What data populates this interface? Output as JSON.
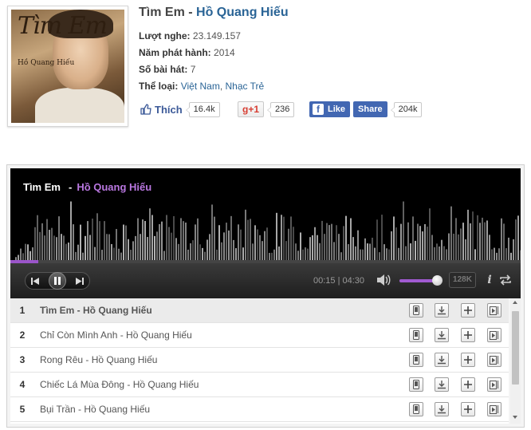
{
  "album": {
    "title": "Tìm Em",
    "separator": "-",
    "artist": "Hồ Quang Hiếu",
    "cover_art_text": {
      "title": "Tìm Em",
      "artist": "Hồ Quang Hiếu"
    },
    "listens_label": "Lượt nghe:",
    "listens_value": "23.149.157",
    "year_label": "Năm phát hành:",
    "year_value": "2014",
    "tracks_label": "Số bài hát:",
    "tracks_value": "7",
    "genre_label": "Thể loại:",
    "genres": [
      "Việt Nam",
      "Nhạc Trẻ"
    ],
    "genre_separator": ","
  },
  "social": {
    "like_label": "Thích",
    "like_count": "16.4k",
    "gplus_label": "g+1",
    "gplus_count": "236",
    "fb_like_label": "Like",
    "fb_share_label": "Share",
    "fb_count": "204k",
    "fb_color": "#4267b2"
  },
  "player": {
    "now_title": "Tìm Em",
    "now_separator": "-",
    "now_artist": "Hồ Quang Hiếu",
    "elapsed": "00:15",
    "time_separator": "|",
    "duration": "04:30",
    "progress_fraction": 0.055,
    "volume_fraction": 0.9,
    "quality": "128K",
    "info_label": "i",
    "accent_color": "#9b55c9"
  },
  "playlist": [
    {
      "num": "1",
      "song": "Tìm Em - Hồ Quang Hiếu",
      "active": true
    },
    {
      "num": "2",
      "song": "Chỉ Còn Mình Anh - Hồ Quang Hiếu",
      "active": false
    },
    {
      "num": "3",
      "song": "Rong Rêu - Hồ Quang Hiếu",
      "active": false
    },
    {
      "num": "4",
      "song": "Chiếc Lá Mùa Đông - Hồ Quang Hiếu",
      "active": false
    },
    {
      "num": "5",
      "song": "Bụi Trần - Hồ Quang Hiếu",
      "active": false
    }
  ],
  "row_actions": [
    "mobile-icon",
    "download-icon",
    "add-icon",
    "play-next-icon"
  ]
}
